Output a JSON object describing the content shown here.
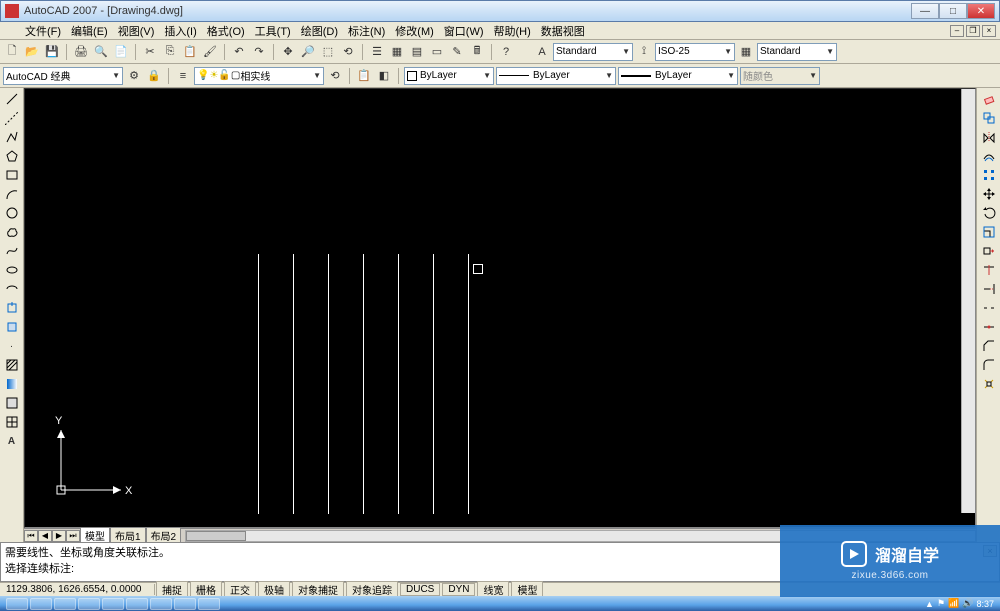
{
  "titlebar": {
    "title": "AutoCAD 2007 - [Drawing4.dwg]"
  },
  "menu": {
    "items": [
      "文件(F)",
      "编辑(E)",
      "视图(V)",
      "插入(I)",
      "格式(O)",
      "工具(T)",
      "绘图(D)",
      "标注(N)",
      "修改(M)",
      "窗口(W)",
      "帮助(H)",
      "数据视图"
    ]
  },
  "toolbar1": {
    "text_style": "Standard",
    "dim_style": "ISO-25",
    "table_style": "Standard"
  },
  "toolbar2": {
    "workspace": "AutoCAD 经典",
    "layer": "相实线",
    "color": "ByLayer",
    "linetype": "ByLayer",
    "lineweight": "ByLayer",
    "plotstyle": "随颜色"
  },
  "layout_tabs": {
    "active": "模型",
    "t1": "布局1",
    "t2": "布局2"
  },
  "command": {
    "line1": "需要线性、坐标或角度关联标注。",
    "line2": "选择连续标注:"
  },
  "status": {
    "coords": "1129.3806, 1626.6554, 0.0000",
    "toggles": [
      "捕捉",
      "栅格",
      "正交",
      "极轴",
      "对象捕捉",
      "对象追踪",
      "DUCS",
      "DYN",
      "线宽",
      "模型"
    ]
  },
  "watermark": {
    "brand": "溜溜自学",
    "url": "zixue.3d66.com"
  },
  "taskbar": {
    "clock": "8:37"
  }
}
